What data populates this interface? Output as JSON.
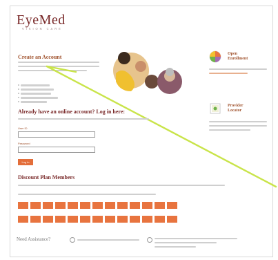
{
  "logo": {
    "brand": "EyeMed",
    "tagline": "VISION CARE"
  },
  "create": {
    "heading": "Create an Account"
  },
  "side": {
    "open_title": "Open Enrollment",
    "provider_title": "Provider Locator"
  },
  "login": {
    "heading": "Already have an online account? Log in here:",
    "user_label": "User ID",
    "password_label": "Password",
    "button": "Log in"
  },
  "discount": {
    "heading": "Discount Plan Members"
  },
  "footer": {
    "need": "Need Assistance?"
  },
  "colors": {
    "accent": "#e8743f",
    "brand": "#7a2a2a",
    "highlight": "#c9e44a"
  }
}
